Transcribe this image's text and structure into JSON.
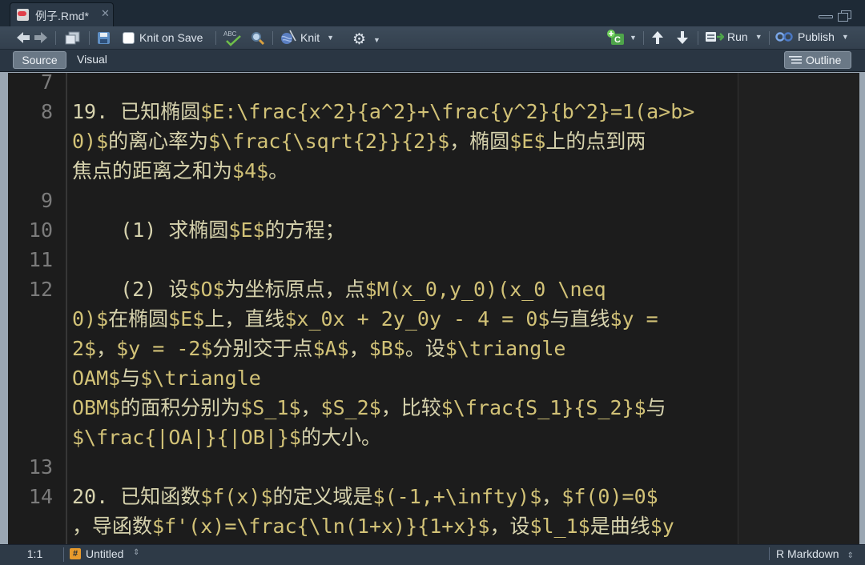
{
  "tab": {
    "title": "例子.Rmd*",
    "close": "✕"
  },
  "toolbar": {
    "knit_on_save": "Knit on Save",
    "knit": "Knit",
    "run": "Run",
    "publish": "Publish",
    "spell_icon_text": "ABC",
    "insert_chunk_letter": "C"
  },
  "mode": {
    "source": "Source",
    "visual": "Visual",
    "outline": "Outline"
  },
  "editor": {
    "line_numbers": [
      "7",
      "8",
      "9",
      "10",
      "11",
      "12",
      "13",
      "14"
    ],
    "lines": [
      [
        [
          "t",
          "19. 已知椭圆"
        ],
        [
          "m",
          "$E:\\frac{x^2}{a^2}+\\frac{y^2}{b^2}=1(a>b>"
        ]
      ],
      [
        [
          "m",
          "0)$"
        ],
        [
          "t",
          "的离心率为"
        ],
        [
          "m",
          "$\\frac{\\sqrt{2}}{2}$"
        ],
        [
          "t",
          "，椭圆"
        ],
        [
          "m",
          "$E$"
        ],
        [
          "t",
          "上的点到两"
        ]
      ],
      [
        [
          "t",
          "焦点的距离之和为"
        ],
        [
          "m",
          "$4$"
        ],
        [
          "t",
          "。"
        ]
      ],
      [
        [
          "t",
          "    (1) 求椭圆"
        ],
        [
          "m",
          "$E$"
        ],
        [
          "t",
          "的方程；"
        ]
      ],
      [
        [
          "t",
          "    (2) 设"
        ],
        [
          "m",
          "$O$"
        ],
        [
          "t",
          "为坐标原点，点"
        ],
        [
          "m",
          "$M(x_0,y_0)(x_0 \\neq"
        ]
      ],
      [
        [
          "m",
          "0)$"
        ],
        [
          "t",
          "在椭圆"
        ],
        [
          "m",
          "$E$"
        ],
        [
          "t",
          "上，直线"
        ],
        [
          "m",
          "$x_0x + 2y_0y - 4 = 0$"
        ],
        [
          "t",
          "与直线"
        ],
        [
          "m",
          "$y ="
        ]
      ],
      [
        [
          "m",
          "2$"
        ],
        [
          "t",
          "，"
        ],
        [
          "m",
          "$y = -2$"
        ],
        [
          "t",
          "分别交于点"
        ],
        [
          "m",
          "$A$"
        ],
        [
          "t",
          "，"
        ],
        [
          "m",
          "$B$"
        ],
        [
          "t",
          "。设"
        ],
        [
          "m",
          "$\\triangle"
        ]
      ],
      [
        [
          "m",
          "OAM$"
        ],
        [
          "t",
          "与"
        ],
        [
          "m",
          "$\\triangle"
        ]
      ],
      [
        [
          "m",
          "OBM$"
        ],
        [
          "t",
          "的面积分别为"
        ],
        [
          "m",
          "$S_1$"
        ],
        [
          "t",
          "，"
        ],
        [
          "m",
          "$S_2$"
        ],
        [
          "t",
          "，比较"
        ],
        [
          "m",
          "$\\frac{S_1}{S_2}$"
        ],
        [
          "t",
          "与"
        ]
      ],
      [
        [
          "m",
          "$\\frac{|OA|}{|OB|}$"
        ],
        [
          "t",
          "的大小。"
        ]
      ],
      [
        [
          "t",
          "20. 已知函数"
        ],
        [
          "m",
          "$f(x)$"
        ],
        [
          "t",
          "的定义域是"
        ],
        [
          "m",
          "$(-1,+\\infty)$"
        ],
        [
          "t",
          "，"
        ],
        [
          "m",
          "$f(0)=0$"
        ]
      ],
      [
        [
          "t",
          "，导函数"
        ],
        [
          "m",
          "$f'(x)=\\frac{\\ln(1+x)}{1+x}$"
        ],
        [
          "t",
          "，设"
        ],
        [
          "m",
          "$l_1$"
        ],
        [
          "t",
          "是曲线"
        ],
        [
          "m",
          "$y"
        ]
      ]
    ]
  },
  "status": {
    "position": "1:1",
    "scope": "Untitled",
    "filetype": "R Markdown"
  },
  "colors": {
    "text": "#d6d2ad",
    "math": "#d2c277",
    "gutter_text": "#7b7b7b",
    "editor_bg": "#1c1c1c",
    "toolbar_bg": "#3a4755"
  }
}
